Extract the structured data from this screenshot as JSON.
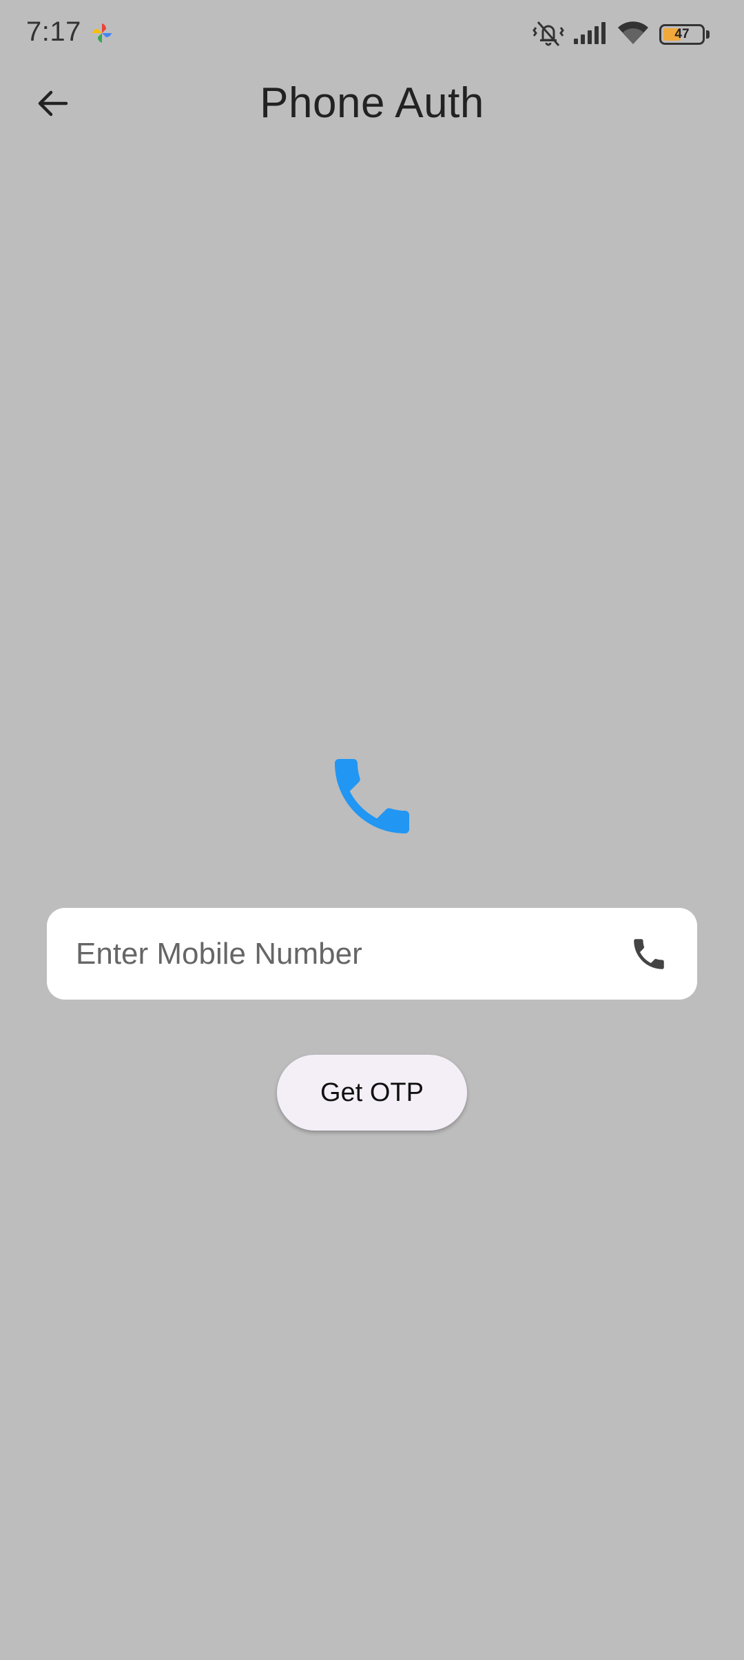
{
  "status_bar": {
    "time": "7:17",
    "app_icon": "pinwheel-icon",
    "icons": [
      "vibrate-off-icon",
      "signal-icon",
      "wifi-icon"
    ],
    "battery_level": "47",
    "battery_color": "#f2a93b"
  },
  "app_bar": {
    "back_icon": "arrow-back-icon",
    "title": "Phone Auth"
  },
  "hero": {
    "icon": "phone-icon",
    "color": "#2196f3"
  },
  "mobile_input": {
    "placeholder": "Enter Mobile Number",
    "value": "",
    "suffix_icon": "phone-icon"
  },
  "get_otp_button": {
    "label": "Get OTP"
  },
  "colors": {
    "background": "#bdbdbd",
    "input_background": "#ffffff",
    "button_background": "#f4eff7"
  }
}
